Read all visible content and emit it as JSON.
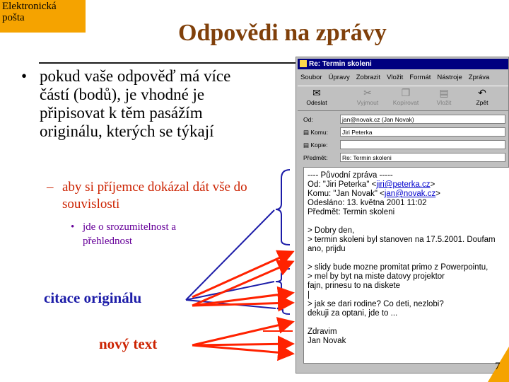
{
  "corner_label": "Elektronická\npošta",
  "title": "Odpovědi na zprávy",
  "bullets": {
    "main": "pokud vaše odpověď má více částí (bodů), je vhodné je připisovat k těm pasážím originálu, kterých se týkají",
    "sub": "aby si příjemce dokázal dát vše do souvislosti",
    "subsub": "jde o srozumitelnost a přehlednost"
  },
  "labels": {
    "quote": "citace originálu",
    "new_text": "nový text"
  },
  "page_number": "7",
  "colors": {
    "title": "#80400a",
    "accent": "#f5a300",
    "quote": "#1c1ca8",
    "new_text": "#cc2200"
  },
  "email_window": {
    "title": "Re: Termin skoleni",
    "menu": [
      "Soubor",
      "Úpravy",
      "Zobrazit",
      "Vložit",
      "Formát",
      "Nástroje",
      "Zpráva"
    ],
    "toolbar": [
      {
        "label": "Odeslat",
        "icon": "send-icon",
        "enabled": true
      },
      {
        "label": "Vyjmout",
        "icon": "cut-icon",
        "enabled": false
      },
      {
        "label": "Kopírovat",
        "icon": "copy-icon",
        "enabled": false
      },
      {
        "label": "Vložit",
        "icon": "paste-icon",
        "enabled": false
      },
      {
        "label": "Zpět",
        "icon": "undo-icon",
        "enabled": true
      }
    ],
    "from": {
      "label": "Od:",
      "value": "jan@novak.cz   (Jan Novak)"
    },
    "to": {
      "label": "Komu:",
      "value": "Jiri Peterka"
    },
    "cc": {
      "label": "Kopie:",
      "value": ""
    },
    "subject": {
      "label": "Předmět:",
      "value": "Re: Termin skoleni"
    },
    "body": {
      "orig_header": "---- Původní zpráva -----",
      "od_prefix": "Od: \"Jiri Peterka\" <",
      "od_link": "jiri@peterka.cz",
      "od_suffix": ">",
      "komu_prefix": "Komu: \"Jan Novak\" <",
      "komu_link": "jan@novak.cz",
      "komu_suffix": ">",
      "odeslano": "Odesláno: 13. května 2001 11:02",
      "predmet": "Předmět: Termin skoleni",
      "q1": "> Dobry den,",
      "q2": "> termin skoleni byl stanoven na 17.5.2001. Doufam",
      "n1": "ano, prijdu",
      "q3": "> slidy bude mozne promitat primo z Powerpointu,",
      "q4": "> mel by byt na miste datovy projektor",
      "n2": "fajn, prinesu to na diskete",
      "cursor": "|",
      "q5": "> jak se dari rodine? Co deti, nezlobi?",
      "n3": "dekuji za optani, jde to ...",
      "n4": "Zdravim",
      "n5": "Jan Novak"
    }
  }
}
